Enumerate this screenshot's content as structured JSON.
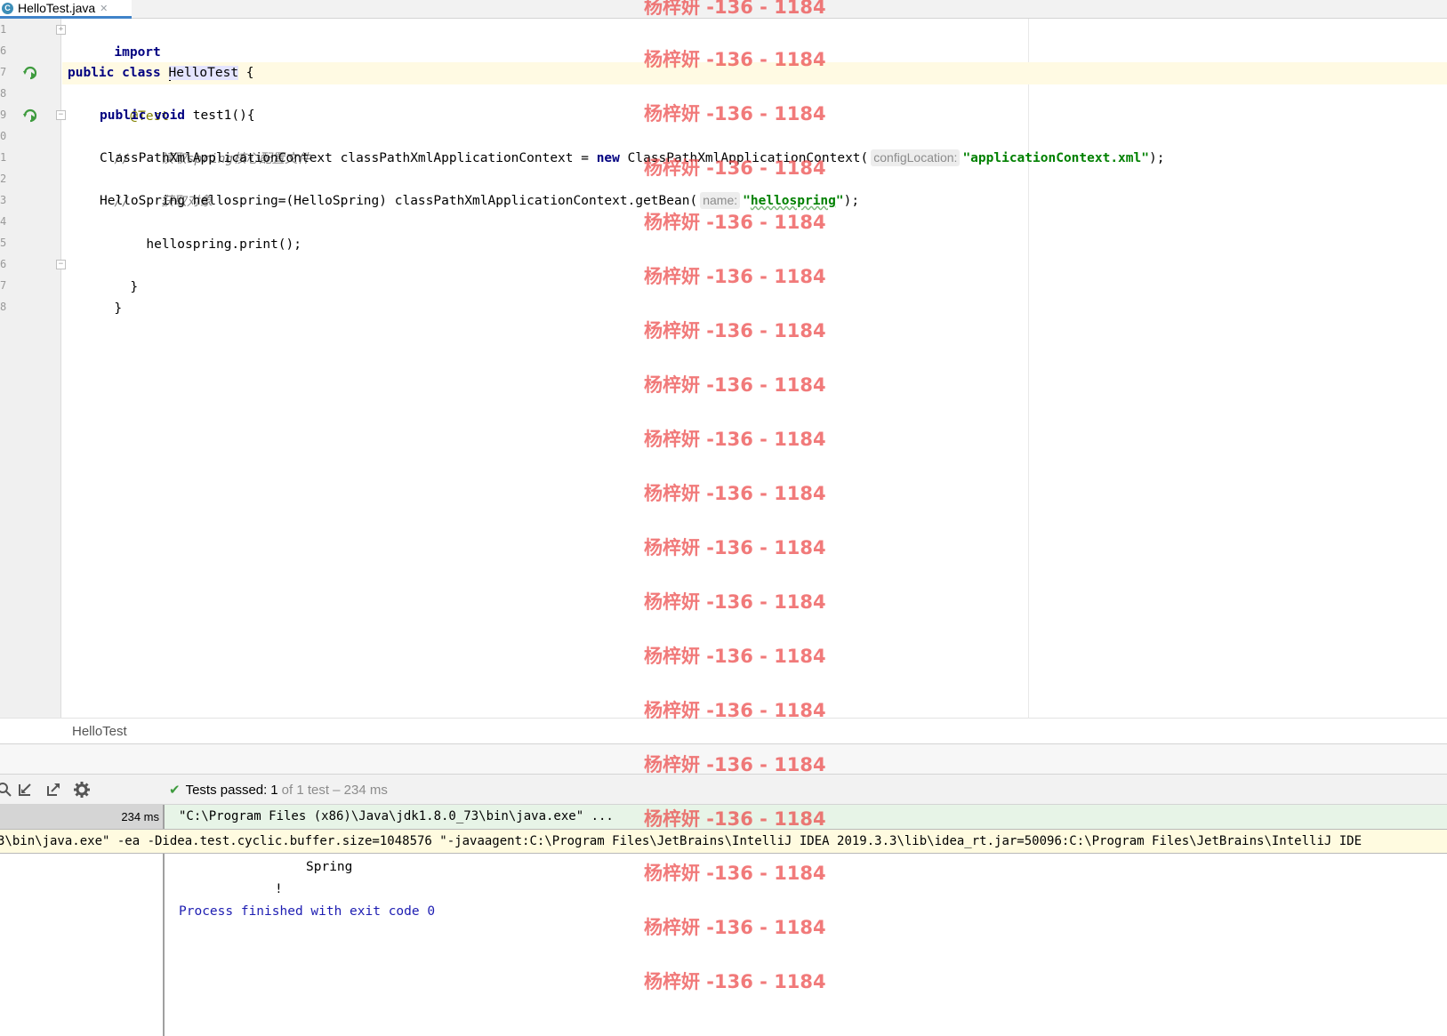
{
  "tab": {
    "icon_letter": "C",
    "label": "HelloTest.java",
    "close_glyph": "✕"
  },
  "gutter": {
    "lines": [
      "1",
      "6",
      "7",
      "8",
      "9",
      "0",
      "1",
      "2",
      "3",
      "4",
      "5",
      "6",
      "7",
      "8"
    ]
  },
  "code": {
    "l1_kw": "import",
    "l1_fold": "...",
    "l3_kw": "public class",
    "l3_class": "HelloTest",
    "l3_rest": " {",
    "l4_anno": "@Test",
    "l5_kw": "public void",
    "l5_rest": " test1(){",
    "l6_comment": "//    读取spring核心配置文件",
    "l7_a": "ClassPathXmlApplicationContext classPathXmlApplicationContext = ",
    "l7_kw": "new",
    "l7_b": " ClassPathXmlApplicationContext(",
    "l7_hint": "configLocation:",
    "l7_str": "\"applicationContext.xml\"",
    "l7_end": ");",
    "l8_comment": "//    获取对象",
    "l9_a": "HelloSpring hellospring=(HelloSpring) classPathXmlApplicationContext.getBean(",
    "l9_hint": "name:",
    "l9_str_open": "\"",
    "l9_str_mid": "hellospring",
    "l9_str_close": "\"",
    "l9_end": ");",
    "l10": "hellospring.print();",
    "l12": "}",
    "l13": "}"
  },
  "breadcrumb": {
    "label": "HelloTest"
  },
  "run_toolbar": {
    "status_main": "Tests passed:",
    "status_count": "1",
    "status_rest": "of 1 test – 234 ms"
  },
  "test_tree": {
    "time": "234 ms"
  },
  "console": {
    "command": "\"C:\\Program Files (x86)\\Java\\jdk1.8.0_73\\bin\\java.exe\" ...",
    "tooltip": "3\\bin\\java.exe\" -ea -Didea.test.cyclic.buffer.size=1048576 \"-javaagent:C:\\Program Files\\JetBrains\\IntelliJ IDEA 2019.3.3\\lib\\idea_rt.jar=50096:C:\\Program Files\\JetBrains\\IntelliJ IDE",
    "out1": "Spring",
    "out2": "!",
    "finished": "Process finished with exit code 0"
  },
  "watermark": {
    "text": "杨梓妍 -136 - 1184"
  },
  "colors": {
    "keyword": "#000080",
    "string": "#008000",
    "comment": "#808080",
    "annotation": "#808000",
    "pass": "#3e9b3e",
    "watermark": "#eb4646"
  }
}
